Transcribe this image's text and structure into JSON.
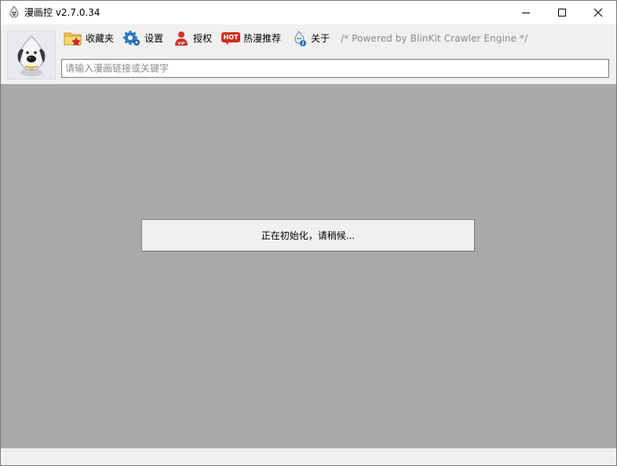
{
  "window": {
    "title": "漫画控 v2.7.0.34",
    "minimize_icon": "minimize-icon",
    "maximize_icon": "maximize-icon",
    "close_icon": "close-icon"
  },
  "toolbar": {
    "items": [
      {
        "label": "收藏夹",
        "icon": "favorites-folder-icon"
      },
      {
        "label": "设置",
        "icon": "gear-icon"
      },
      {
        "label": "授权",
        "icon": "vip-user-icon"
      },
      {
        "label": "热漫推荐",
        "icon": "hot-badge-icon",
        "badge": "HOT"
      },
      {
        "label": "关于",
        "icon": "info-icon"
      }
    ],
    "powered_by": "/* Powered by BlinKit Crawler Engine */"
  },
  "search": {
    "value": "",
    "placeholder": "请输入漫画链接或关键字"
  },
  "main": {
    "status_message": "正在初始化，请稍候..."
  },
  "colors": {
    "content_bg": "#a9a9a9",
    "chrome_bg": "#f0f0f0",
    "hot_badge": "#d42a1e",
    "gear_blue": "#2a78c8",
    "powered_text": "#8a8a8a"
  }
}
